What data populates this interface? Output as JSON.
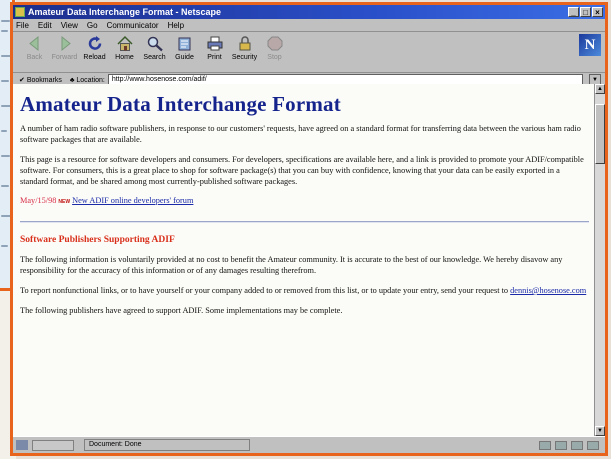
{
  "window": {
    "title": "Amateur Data Interchange Format - Netscape",
    "controls": [
      "_",
      "□",
      "×"
    ]
  },
  "menubar": [
    "File",
    "Edit",
    "View",
    "Go",
    "Communicator",
    "Help"
  ],
  "toolbar": {
    "buttons": [
      {
        "label": "Back",
        "icon": "back-arrow-icon",
        "enabled": false
      },
      {
        "label": "Forward",
        "icon": "forward-arrow-icon",
        "enabled": false
      },
      {
        "label": "Reload",
        "icon": "reload-icon",
        "enabled": true
      },
      {
        "label": "Home",
        "icon": "home-icon",
        "enabled": true
      },
      {
        "label": "Search",
        "icon": "search-icon",
        "enabled": true
      },
      {
        "label": "Guide",
        "icon": "guide-icon",
        "enabled": true
      },
      {
        "label": "Print",
        "icon": "print-icon",
        "enabled": true
      },
      {
        "label": "Security",
        "icon": "security-icon",
        "enabled": true
      },
      {
        "label": "Stop",
        "icon": "stop-icon",
        "enabled": false
      }
    ],
    "brand_letter": "N"
  },
  "location": {
    "bookmarks_label": "Bookmarks",
    "location_label": "Location:",
    "url": "http://www.hosenose.com/adif/"
  },
  "page": {
    "heading": "Amateur Data Interchange Format",
    "intro": "A number of ham radio software publishers, in response to our customers' requests, have agreed on a standard format for transferring data between the various ham radio software packages that are available.",
    "resource": "This page is a resource for software developers and consumers.  For developers, specifications are available here, and a link is provided to promote your ADIF/compatible software.  For consumers, this is a great place to shop for software package(s) that you can buy with confidence, knowing that your data can be easily exported in a standard format, and be shared among most currently-published software packages.",
    "news": {
      "date": "May/15/98",
      "badge": "NEW",
      "link": "New ADIF online developers' forum"
    },
    "section_heading": "Software Publishers Supporting ADIF",
    "disclaimer": "The following information is voluntarily provided at no cost to benefit the Amateur community. It is accurate to the best of our knowledge. We hereby disavow any responsibility for the accuracy of this information or of any damages resulting therefrom.",
    "report_before": "To report nonfunctional links, or to have yourself or your company added to or removed from this list, or to update your entry, send your request to ",
    "report_email": "dennis@hosenose.com",
    "publishers": "The following publishers have agreed to support ADIF.  Some implementations may be complete."
  },
  "status": {
    "text": "Document: Done"
  },
  "colors": {
    "heading": "#15238c",
    "section_heading": "#d9301c",
    "news_date": "#d9304a",
    "link": "#1a2aa8",
    "frame_accent": "#e8631c"
  }
}
